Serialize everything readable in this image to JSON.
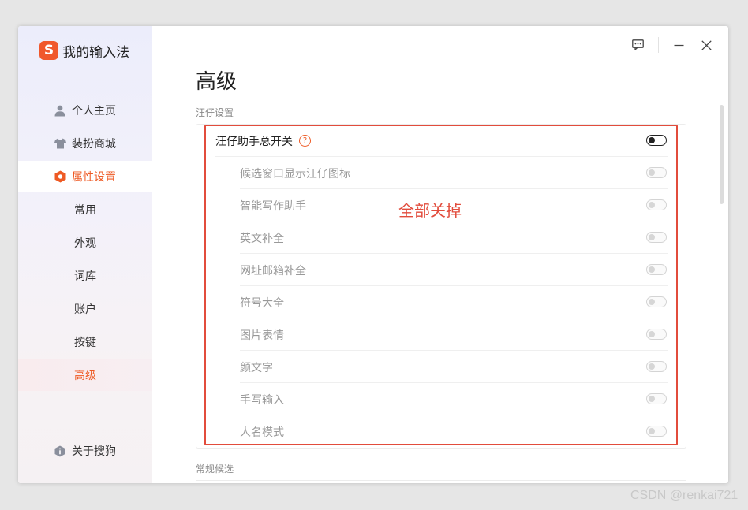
{
  "app": {
    "logo_glyph": "S",
    "title": "我的输入法",
    "brand_color": "#f0582c"
  },
  "sidebar": {
    "nav": [
      {
        "label": "个人主页",
        "icon": "user-icon"
      },
      {
        "label": "装扮商城",
        "icon": "shirt-icon"
      },
      {
        "label": "属性设置",
        "icon": "hexagon-settings-icon",
        "active": true
      }
    ],
    "sub_items": [
      {
        "label": "常用"
      },
      {
        "label": "外观"
      },
      {
        "label": "词库"
      },
      {
        "label": "账户"
      },
      {
        "label": "按键"
      },
      {
        "label": "高级",
        "active": true
      }
    ],
    "about": {
      "label": "关于搜狗",
      "icon": "info-shield-icon"
    }
  },
  "main": {
    "title": "高级",
    "section1": "汪仔设置",
    "master": {
      "label": "汪仔助手总开关",
      "help": "?",
      "on": false
    },
    "items": [
      {
        "label": "候选窗口显示汪仔图标",
        "on": false,
        "disabled": true
      },
      {
        "label": "智能写作助手",
        "on": false,
        "disabled": true
      },
      {
        "label": "英文补全",
        "on": false,
        "disabled": true
      },
      {
        "label": "网址邮箱补全",
        "on": false,
        "disabled": true
      },
      {
        "label": "符号大全",
        "on": false,
        "disabled": true
      },
      {
        "label": "图片表情",
        "on": false,
        "disabled": true
      },
      {
        "label": "颜文字",
        "on": false,
        "disabled": true
      },
      {
        "label": "手写输入",
        "on": false,
        "disabled": true
      },
      {
        "label": "人名模式",
        "on": false,
        "disabled": true
      }
    ],
    "section2": "常规候选"
  },
  "annotation": {
    "text": "全部关掉",
    "color": "#e24c3c"
  },
  "titlebar": {
    "icons": [
      "feedback-icon",
      "minimize-icon",
      "close-icon"
    ]
  },
  "watermark": "CSDN @renkai721",
  "colors": {
    "accent": "#ee5a24",
    "annotation": "#e24c3c"
  }
}
